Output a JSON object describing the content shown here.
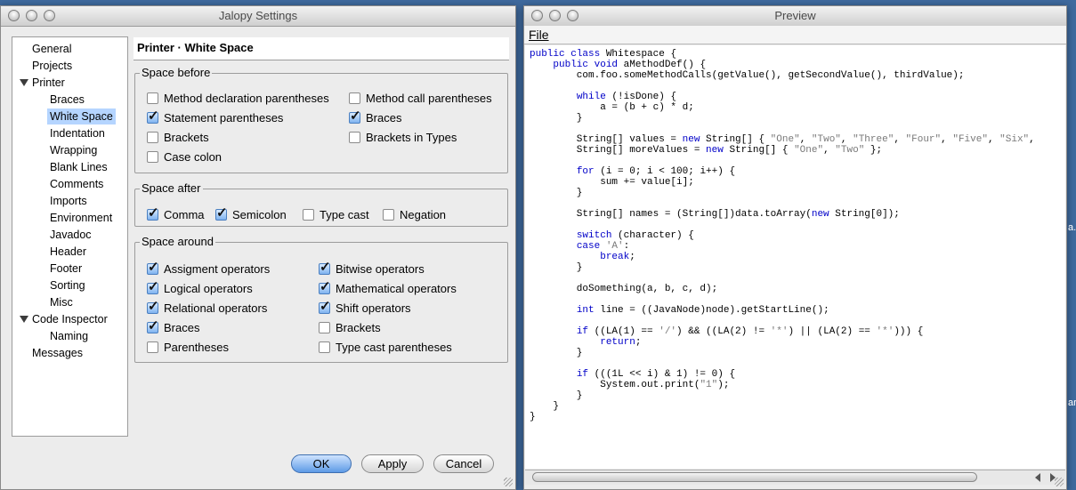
{
  "settings_window": {
    "title": "Jalopy Settings",
    "tree": [
      {
        "label": "General",
        "level": 0
      },
      {
        "label": "Projects",
        "level": 0
      },
      {
        "label": "Printer",
        "level": 0,
        "expanded": true
      },
      {
        "label": "Braces",
        "level": 1
      },
      {
        "label": "White Space",
        "level": 1,
        "selected": true
      },
      {
        "label": "Indentation",
        "level": 1
      },
      {
        "label": "Wrapping",
        "level": 1
      },
      {
        "label": "Blank Lines",
        "level": 1
      },
      {
        "label": "Comments",
        "level": 1
      },
      {
        "label": "Imports",
        "level": 1
      },
      {
        "label": "Environment",
        "level": 1
      },
      {
        "label": "Javadoc",
        "level": 1
      },
      {
        "label": "Header",
        "level": 1
      },
      {
        "label": "Footer",
        "level": 1
      },
      {
        "label": "Sorting",
        "level": 1
      },
      {
        "label": "Misc",
        "level": 1
      },
      {
        "label": "Code Inspector",
        "level": 0,
        "expanded": true
      },
      {
        "label": "Naming",
        "level": 1
      },
      {
        "label": "Messages",
        "level": 0
      }
    ],
    "panel_title": "Printer · White Space",
    "space_before": {
      "title": "Space before",
      "items": [
        {
          "label": "Method declaration parentheses",
          "checked": false
        },
        {
          "label": "Method call parentheses",
          "checked": false
        },
        {
          "label": "Statement parentheses",
          "checked": true
        },
        {
          "label": "Braces",
          "checked": true
        },
        {
          "label": "Brackets",
          "checked": false
        },
        {
          "label": "Brackets in Types",
          "checked": false
        },
        {
          "label": "Case colon",
          "checked": false
        }
      ]
    },
    "space_after": {
      "title": "Space after",
      "items": [
        {
          "label": "Comma",
          "checked": true
        },
        {
          "label": "Semicolon",
          "checked": true
        },
        {
          "label": "Type cast",
          "checked": false
        },
        {
          "label": "Negation",
          "checked": false
        }
      ]
    },
    "space_around": {
      "title": "Space around",
      "items": [
        {
          "label": "Assigment operators",
          "checked": true
        },
        {
          "label": "Bitwise operators",
          "checked": true
        },
        {
          "label": "Logical operators",
          "checked": true
        },
        {
          "label": "Mathematical operators",
          "checked": true
        },
        {
          "label": "Relational operators",
          "checked": true
        },
        {
          "label": "Shift operators",
          "checked": true
        },
        {
          "label": "Braces",
          "checked": true
        },
        {
          "label": "Brackets",
          "checked": false
        },
        {
          "label": "Parentheses",
          "checked": false
        },
        {
          "label": "Type cast parentheses",
          "checked": false
        }
      ]
    },
    "buttons": {
      "ok": "OK",
      "apply": "Apply",
      "cancel": "Cancel"
    }
  },
  "preview_window": {
    "title": "Preview",
    "menu": [
      "File"
    ],
    "code": [
      "public class Whitespace {",
      "    public void aMethodDef() {",
      "        com.foo.someMethodCalls(getValue(), getSecondValue(), thirdValue);",
      "",
      "        while (!isDone) {",
      "            a = (b + c) * d;",
      "        }",
      "",
      "        String[] values = new String[] { \"One\", \"Two\", \"Three\", \"Four\", \"Five\", \"Six\",",
      "        String[] moreValues = new String[] { \"One\", \"Two\" };",
      "",
      "        for (i = 0; i < 100; i++) {",
      "            sum += value[i];",
      "        }",
      "",
      "        String[] names = (String[])data.toArray(new String[0]);",
      "",
      "        switch (character) {",
      "        case 'A':",
      "            break;",
      "        }",
      "",
      "        doSomething(a, b, c, d);",
      "",
      "        int line = ((JavaNode)node).getStartLine();",
      "",
      "        if ((LA(1) == '/') && ((LA(2) != '*') || (LA(2) == '*'))) {",
      "            return;",
      "        }",
      "",
      "        if (((1L << i) & 1) != 0) {",
      "            System.out.print(\"1\");",
      "        }",
      "    }",
      "}"
    ]
  },
  "desktop_fragments": [
    "a.f",
    "ar"
  ]
}
